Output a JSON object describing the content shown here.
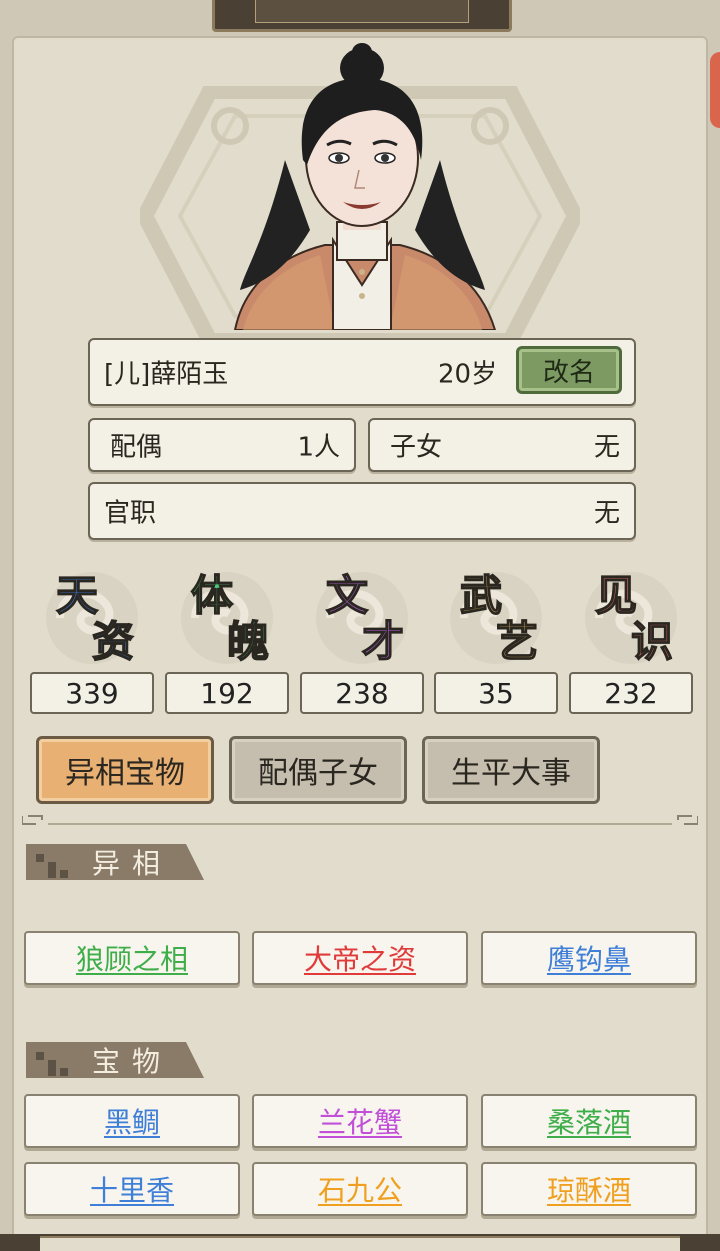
{
  "character": {
    "name_line": "[儿]薛陌玉",
    "age": "20岁",
    "rename_label": "改名"
  },
  "info": {
    "spouse_label": "配偶",
    "spouse_value": "1人",
    "children_label": "子女",
    "children_value": "无",
    "office_label": "官职",
    "office_value": "无"
  },
  "stats": [
    {
      "chars": [
        "天",
        "资"
      ],
      "value": "339",
      "color": "#3a7be0"
    },
    {
      "chars": [
        "体",
        "魄"
      ],
      "value": "192",
      "color": "#4cc878"
    },
    {
      "chars": [
        "文",
        "才"
      ],
      "value": "238",
      "color": "#b660d8"
    },
    {
      "chars": [
        "武",
        "艺"
      ],
      "value": "35",
      "color": "#f0c060"
    },
    {
      "chars": [
        "见",
        "识"
      ],
      "value": "232",
      "color": "#e8706a"
    }
  ],
  "tabs": [
    {
      "label": "异相宝物",
      "active": true
    },
    {
      "label": "配偶子女",
      "active": false
    },
    {
      "label": "生平大事",
      "active": false
    }
  ],
  "sections": {
    "traits_title": "异相",
    "treasures_title": "宝物"
  },
  "traits": [
    {
      "label": "狼顾之相",
      "color": "#3fae4a"
    },
    {
      "label": "大帝之资",
      "color": "#e03a3a"
    },
    {
      "label": "鹰钩鼻",
      "color": "#3f7fd8"
    }
  ],
  "treasures": [
    {
      "label": "黑鲷",
      "color": "#3f7fd8"
    },
    {
      "label": "兰花蟹",
      "color": "#c14fd8"
    },
    {
      "label": "桑落酒",
      "color": "#3fae4a"
    },
    {
      "label": "十里香",
      "color": "#3f7fd8"
    },
    {
      "label": "石九公",
      "color": "#f0a020"
    },
    {
      "label": "琼酥酒",
      "color": "#f0a020"
    }
  ]
}
